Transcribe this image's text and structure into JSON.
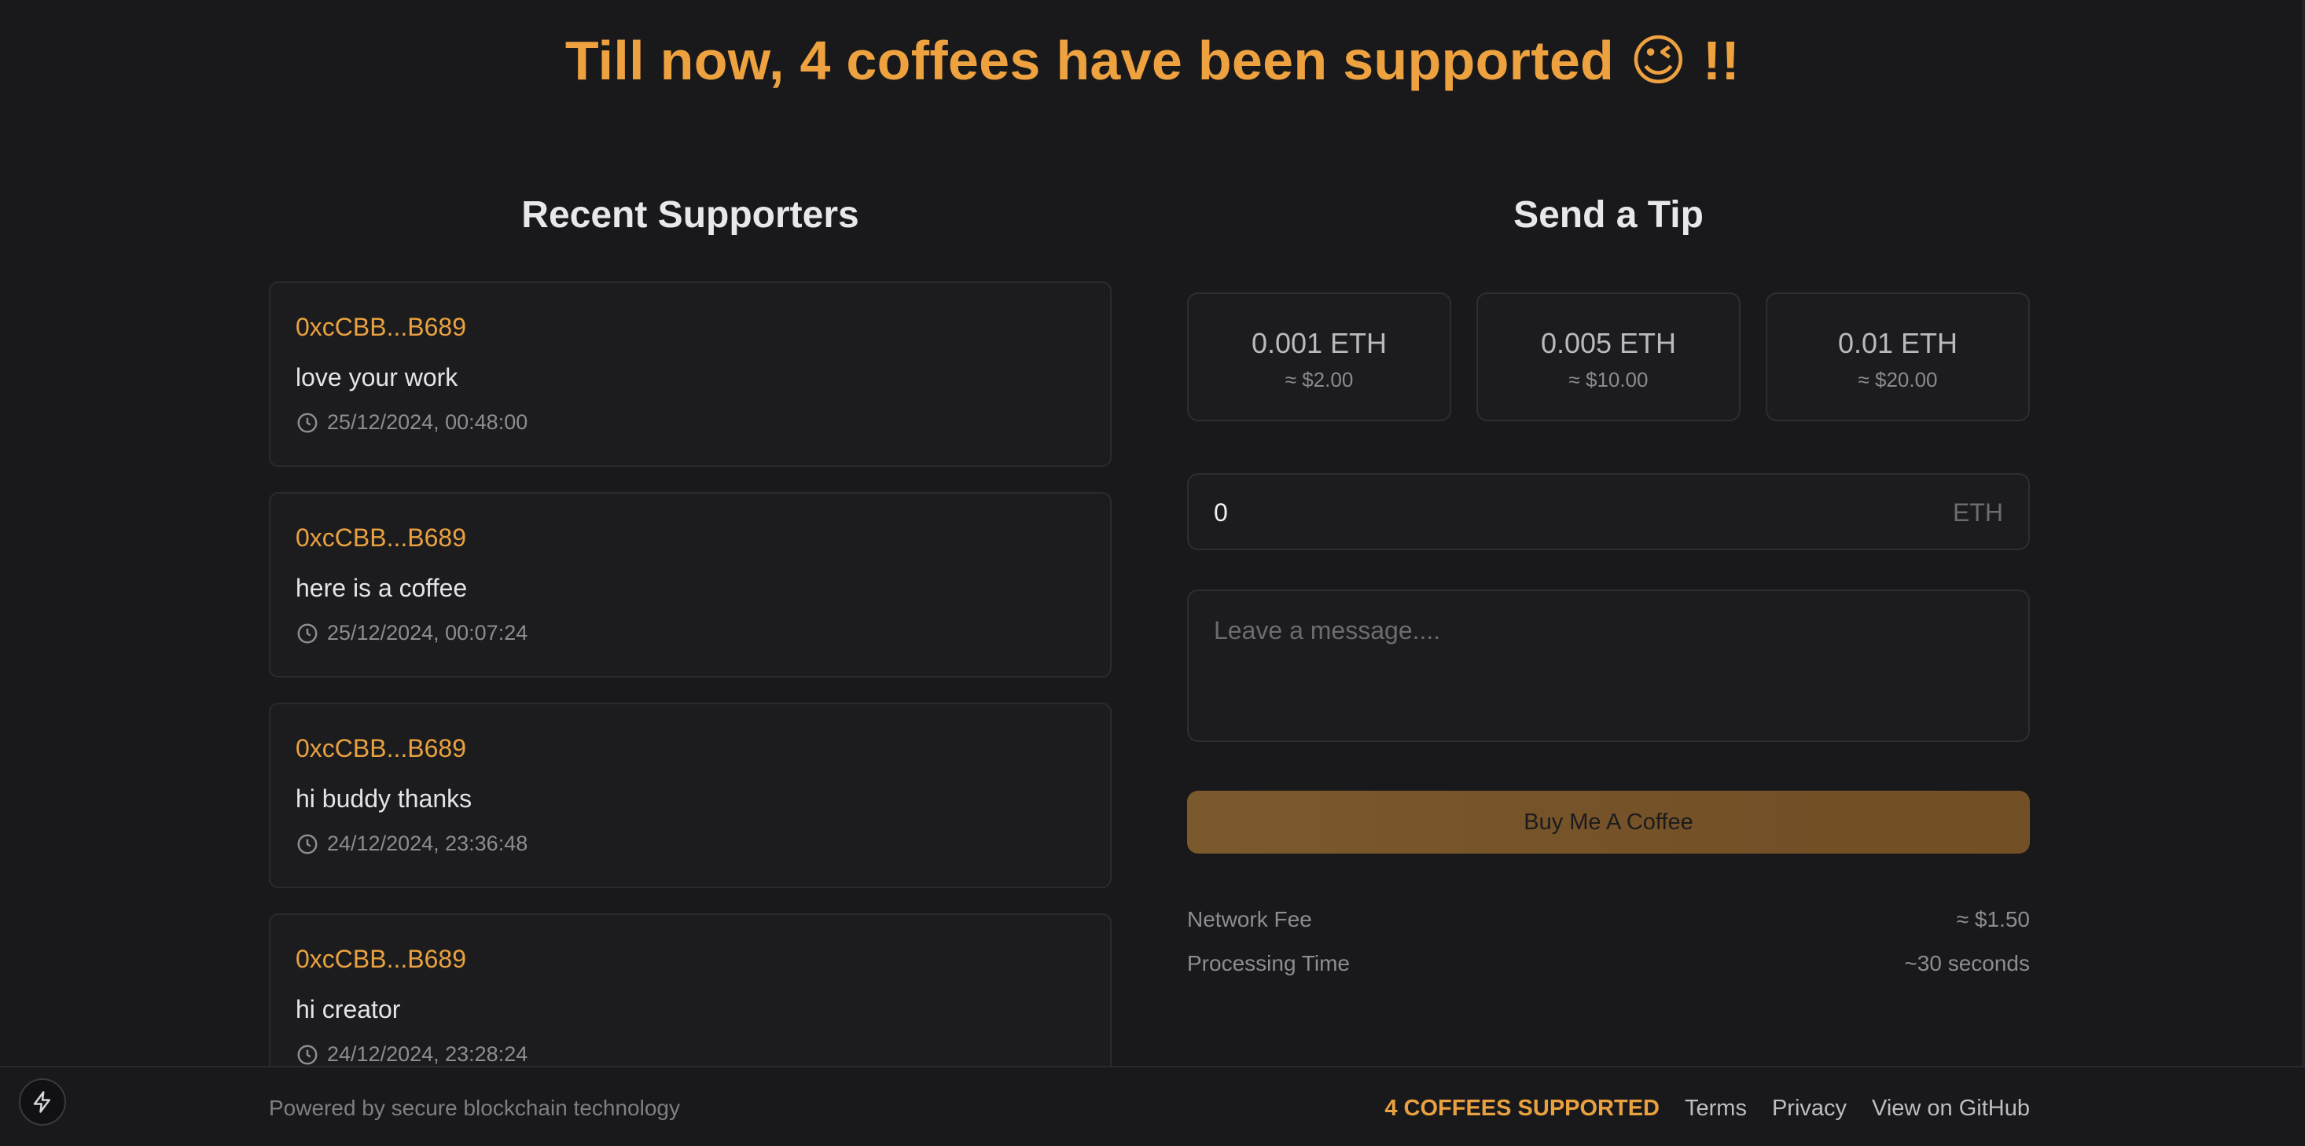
{
  "header": {
    "headline": "Till now, 4 coffees have been supported 😉 !!"
  },
  "supporters": {
    "title": "Recent Supporters",
    "items": [
      {
        "address": "0xcCBB...B689",
        "message": "love your work",
        "time": "25/12/2024, 00:48:00"
      },
      {
        "address": "0xcCBB...B689",
        "message": "here is a coffee",
        "time": "25/12/2024, 00:07:24"
      },
      {
        "address": "0xcCBB...B689",
        "message": "hi buddy thanks",
        "time": "24/12/2024, 23:36:48"
      },
      {
        "address": "0xcCBB...B689",
        "message": "hi creator",
        "time": "24/12/2024, 23:28:24"
      }
    ]
  },
  "tip": {
    "title": "Send a Tip",
    "presets": [
      {
        "eth": "0.001 ETH",
        "usd": "≈ $2.00"
      },
      {
        "eth": "0.005 ETH",
        "usd": "≈ $10.00"
      },
      {
        "eth": "0.01 ETH",
        "usd": "≈ $20.00"
      }
    ],
    "amount_value": "0",
    "amount_unit": "ETH",
    "message_placeholder": "Leave a message....",
    "buy_label": "Buy Me A Coffee",
    "network_fee_label": "Network Fee",
    "network_fee_value": "≈ $1.50",
    "processing_label": "Processing Time",
    "processing_value": "~30 seconds"
  },
  "footer": {
    "powered": "Powered by secure blockchain technology",
    "count_label": "4 COFFEES SUPPORTED",
    "terms": "Terms",
    "privacy": "Privacy",
    "github": "View on GitHub"
  },
  "colors": {
    "accent": "#eda13f",
    "background": "#19191b",
    "card": "#1c1c1f"
  }
}
